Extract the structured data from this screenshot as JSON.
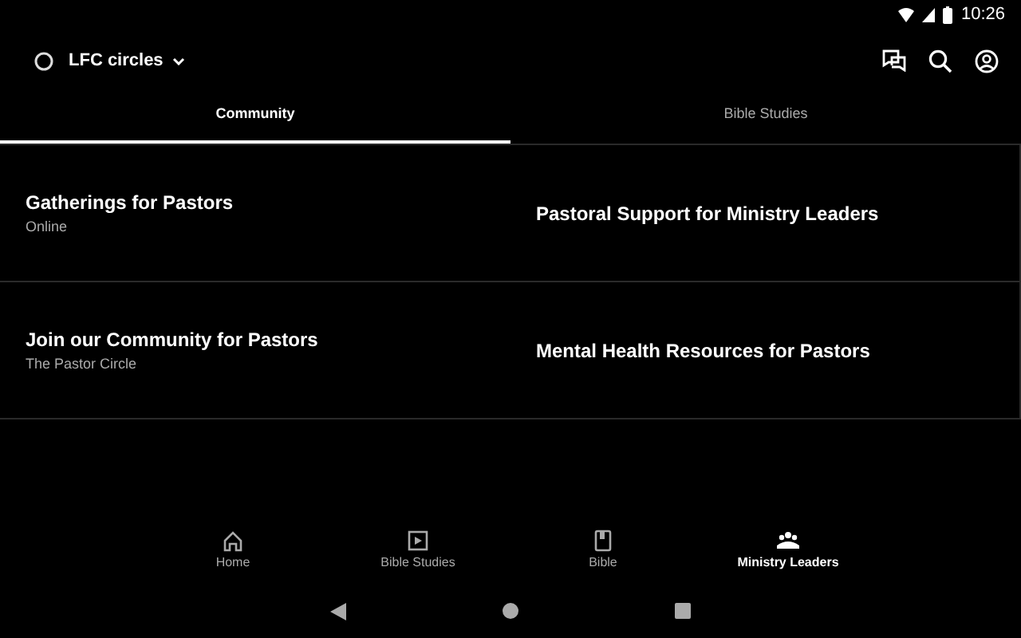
{
  "status_bar": {
    "time": "10:26"
  },
  "app_bar": {
    "title": "LFC circles"
  },
  "tabs": [
    {
      "label": "Community",
      "selected": true
    },
    {
      "label": "Bible Studies",
      "selected": false
    }
  ],
  "cards": [
    {
      "title": "Gatherings for Pastors",
      "subtitle": "Online"
    },
    {
      "title": "Pastoral Support for Ministry Leaders"
    },
    {
      "title": "Join our Community for Pastors",
      "subtitle": "The Pastor Circle"
    },
    {
      "title": "Mental Health Resources for Pastors"
    }
  ],
  "bottom_nav": [
    {
      "label": "Home",
      "kind": "home",
      "selected": false
    },
    {
      "label": "Bible Studies",
      "kind": "video",
      "selected": false
    },
    {
      "label": "Bible",
      "kind": "book",
      "selected": false
    },
    {
      "label": "Ministry Leaders",
      "kind": "group",
      "selected": true
    }
  ]
}
